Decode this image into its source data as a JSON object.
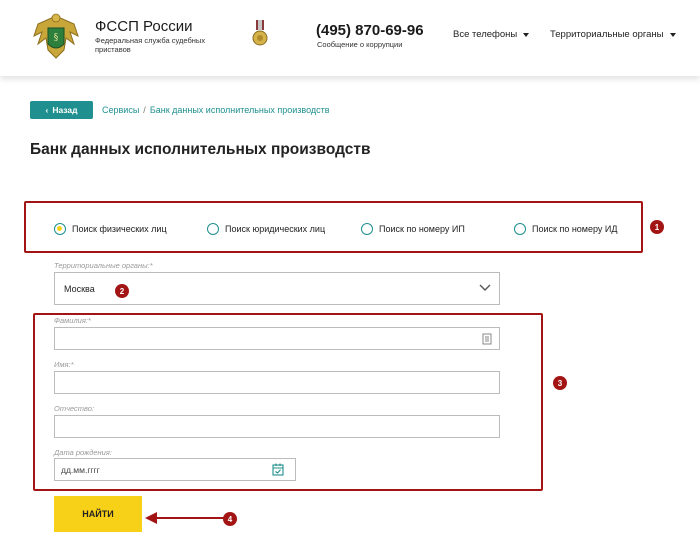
{
  "header": {
    "brand_title": "ФССП России",
    "brand_subtitle": "Федеральная служба судебных приставов",
    "phone": "(495) 870-69-96",
    "phone_subtitle": "Сообщение о коррупции",
    "nav": [
      {
        "label": "Все телефоны"
      },
      {
        "label": "Территориальные органы"
      }
    ]
  },
  "breadcrumb": {
    "back_label": "Назад",
    "items": [
      "Сервисы",
      "Банк данных исполнительных производств"
    ]
  },
  "page_title": "Банк данных исполнительных производств",
  "search_type": {
    "options": [
      {
        "label": "Поиск физических лиц",
        "checked": true
      },
      {
        "label": "Поиск юридических лиц",
        "checked": false
      },
      {
        "label": "Поиск по номеру ИП",
        "checked": false
      },
      {
        "label": "Поиск по номеру ИД",
        "checked": false
      }
    ]
  },
  "form": {
    "region_label": "Территориальные органы:*",
    "region_value": "Москва",
    "lastname_label": "Фамилия:*",
    "lastname_value": "",
    "firstname_label": "Имя:*",
    "firstname_value": "",
    "patronymic_label": "Отчество:",
    "patronymic_value": "",
    "birthdate_label": "Дата рождения:",
    "birthdate_placeholder": "дд.мм.гггг",
    "submit_label": "НАЙТИ"
  },
  "annotations": [
    "1",
    "2",
    "3",
    "4"
  ],
  "colors": {
    "accent": "#1f8f8f",
    "annotation_red": "#a31515",
    "button_yellow": "#f7d117"
  },
  "icons": {
    "logo": "fssp-eagle-emblem",
    "medal": "medal-icon",
    "nav_caret": "caret-down-icon",
    "back": "chevron-left-icon",
    "select": "chevron-down-icon",
    "lastname_field": "contact-card-icon",
    "date_field": "calendar-check-icon"
  }
}
